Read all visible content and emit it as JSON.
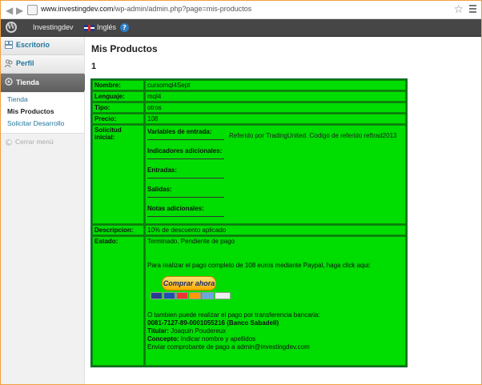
{
  "browser": {
    "url_domain": "www.investingdev.com",
    "url_path": "/wp-admin/admin.php?page=mis-productos"
  },
  "adminbar": {
    "site_name": "Investingdev",
    "language": "Inglés",
    "help": "?"
  },
  "sidebar": {
    "items": [
      {
        "label": "Escritorio",
        "icon": "dashboard-icon"
      },
      {
        "label": "Perfil",
        "icon": "users-icon"
      },
      {
        "label": "Tienda",
        "icon": "tienda-icon"
      }
    ],
    "submenu": [
      {
        "label": "Tienda",
        "current": false
      },
      {
        "label": "Mis Productos",
        "current": true
      },
      {
        "label": "Solicitar Desarrollo",
        "current": false
      }
    ],
    "collapse_label": "Cerrar menú"
  },
  "main": {
    "title": "Mis Productos",
    "number": "1",
    "rows": {
      "nombre": {
        "label": "Nombre:",
        "value": "cursomql4Sept"
      },
      "lenguaje": {
        "label": "Lenguaje:",
        "value": "mql4"
      },
      "tipo": {
        "label": "Tipo:",
        "value": "otros"
      },
      "precio": {
        "label": "Precio:",
        "value": "108"
      },
      "solicitud": {
        "label": "Solicitud inicial:",
        "fields": [
          "Variables de entrada:",
          "Indicadores adicionales:",
          "Entradas:",
          "Salidas:",
          "Notas adicionales:"
        ],
        "referral": "Referido por TradingUnited. Codigo de referido reftrad2013"
      },
      "descripcion": {
        "label": "Descripcion:",
        "value": "10% de descuento aplicado"
      },
      "estado": {
        "label": "Estado:",
        "status": "Terminado. Pendiente de pago",
        "paypal_text": "Para realizar el pago completo de 108 euros mediante Paypal, haga click aqui:",
        "buy_button": "Comprar ahora",
        "transfer_text": "O tambien puede realizar el pago por transferencia bancaria:",
        "account": "0081-7127-89-0001055216 (Banco Sabadell)",
        "titular_label": "Titular:",
        "titular_value": " Joaquin Poudereux",
        "concepto_label": "Concepto:",
        "concepto_value": " Indicar nombre y apellidos",
        "send_text": "Enviar comprobante de pago a admin@investingdev.com"
      }
    }
  }
}
